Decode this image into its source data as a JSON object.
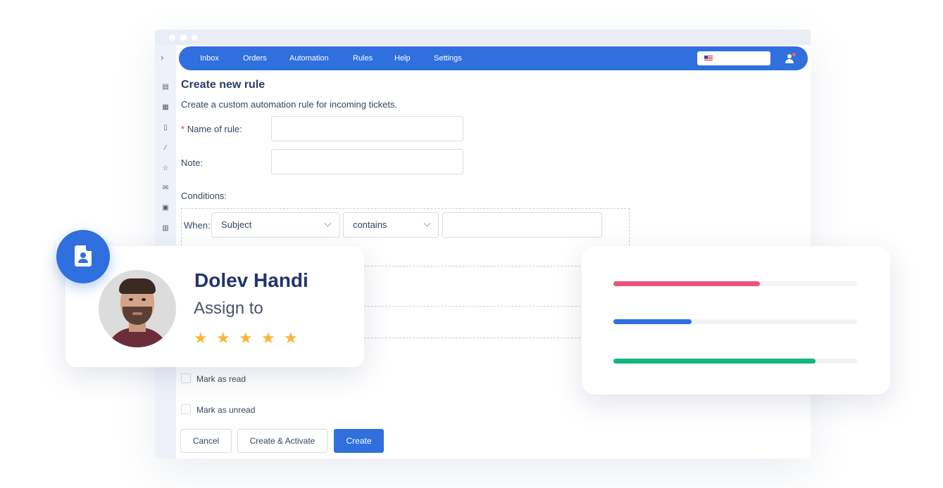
{
  "nav": {
    "items": [
      "Inbox",
      "Orders",
      "Automation",
      "Rules",
      "Help",
      "Settings"
    ]
  },
  "form": {
    "title": "Create new rule",
    "subtitle": "Create a custom automation rule for incoming tickets.",
    "required_mark": "*",
    "name_label": "Name of rule:",
    "note_label": "Note:",
    "conditions_label": "Conditions:",
    "when_label": "When:",
    "field_select": "Subject",
    "operator_select": "contains",
    "mark_read_label": "Mark as read",
    "mark_unread_label": "Mark as unread",
    "cancel_label": "Cancel",
    "create_activate_label": "Create & Activate",
    "create_label": "Create"
  },
  "assign_card": {
    "name": "Dolev Handi",
    "subtitle": "Assign to",
    "rating": 5,
    "star": "★"
  },
  "progress_card": {
    "bars": [
      {
        "color": "#e8557a",
        "fraction": 0.6
      },
      {
        "color": "#2f6fde",
        "fraction": 0.32
      },
      {
        "color": "#12b87b",
        "fraction": 0.83
      }
    ]
  },
  "colors": {
    "accent": "#2f6fde",
    "required": "#e0383e",
    "star": "#f7b733"
  }
}
